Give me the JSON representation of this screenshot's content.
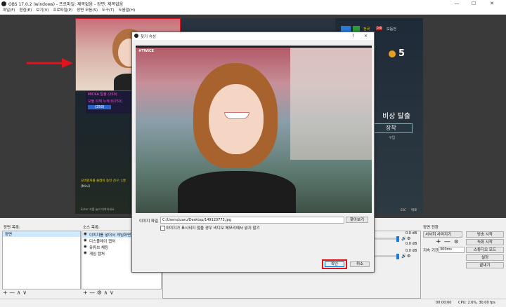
{
  "window": {
    "title": "OBS 17.0.2 (windows) - 프로파일: 제목없음 - 장면: 제목없음",
    "minimize": "—",
    "maximize": "☐",
    "close": "✕"
  },
  "menu": [
    "파일(F)",
    "편집(E)",
    "보기(V)",
    "프로파일(P)",
    "장면 모음(S)",
    "도구(T)",
    "도움말(H)"
  ],
  "game_overlay": {
    "list_items": [
      "MICKA 탈출 (250)",
      "모듈 피해 누적(8/250)",
      "(250)"
    ],
    "score": "5",
    "title_big": "비상 탈출",
    "title_sub": "장착",
    "title_small": "구입",
    "chat_line1": "오버워치를 플레이 중인 친구: 1명",
    "chat_line2": "[Mini]",
    "chat_hint": "Enter 키를 눌러 대화하세요",
    "key_esc": "ESC",
    "key_back": "뒤로",
    "top_right_tag": "전국",
    "top_right_count": "5/6",
    "top_right_mode": "모둠전"
  },
  "panels": {
    "scenes_header": "장면 목록:",
    "scenes": [
      "장면"
    ],
    "sources_header": "소스 목록:",
    "sources": [
      "이미지를 넣어서 게임화면",
      "디스플레이 캡처",
      "유튜브 채팅",
      "게임 캡처"
    ],
    "mixer_db": [
      "0.0 dB",
      "0.0 dB",
      "0.0 dB"
    ],
    "controls_header": "장면 전환",
    "transition_value": "서서히 사라지기",
    "duration_label": "지속 기간",
    "duration_value": "300ms",
    "buttons": [
      "방송 시작",
      "녹화 시작",
      "스튜디오 모드",
      "설정",
      "끝내기"
    ]
  },
  "dialog": {
    "title": "찾기 속성",
    "help": "?",
    "close": "✕",
    "overlay_tag": "#TWICE",
    "file_label": "이미지 파일",
    "file_value": "C:/Users/zzaru/Desktop/149120773.jpg",
    "browse_label": "찾아보기",
    "checkbox_label": "이미지가 표시되지 않을 경우 비디오 메모리에서 읽지 않기",
    "ok_label": "확인",
    "cancel_label": "취소"
  },
  "status": {
    "time": "00:00:00",
    "time2": "00:00:00",
    "cpu": "CPU: 2.6%, 30.00 fps"
  },
  "colors": {
    "highlight_red": "#e0141e",
    "button_blue": "#1e7ad6"
  }
}
